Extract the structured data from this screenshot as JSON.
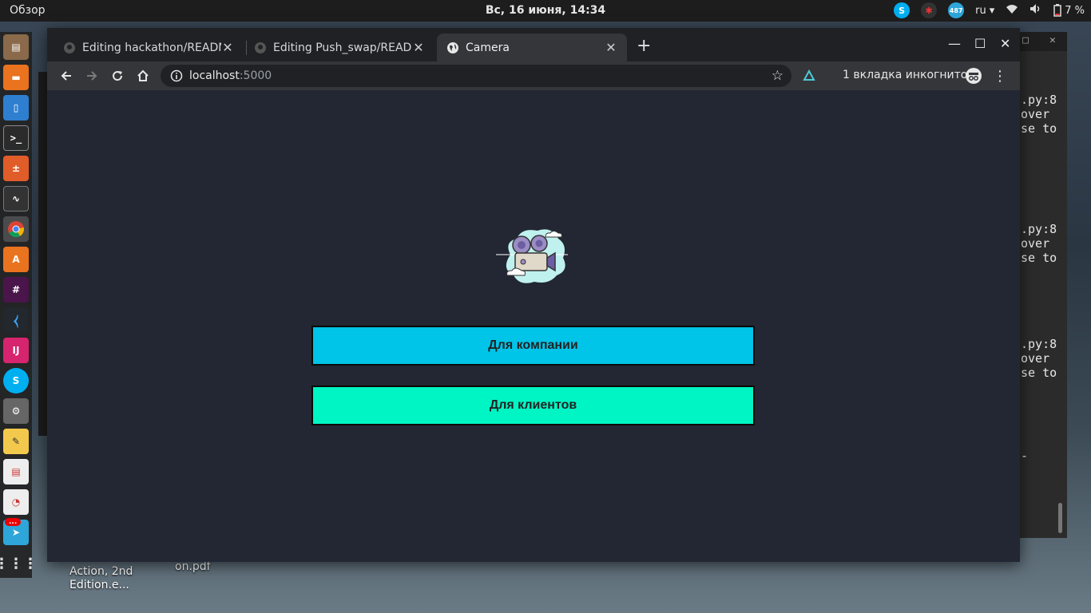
{
  "top_panel": {
    "overview": "Обзор",
    "clock": "Вс, 16 июня, 14:34",
    "lang": "ru",
    "battery": "7 %",
    "telegram_badge": "487"
  },
  "dock": {
    "items": [
      "files-cabinet",
      "folder",
      "document-viewer",
      "terminal",
      "calculator",
      "system-monitor",
      "chrome",
      "software-center",
      "slack",
      "vscode",
      "intellij",
      "skype",
      "settings",
      "text-editor",
      "pdf-viewer",
      "presentation",
      "telegram",
      "app-grid"
    ],
    "telegram_notif": "..."
  },
  "desktop": {
    "label1_line1": "Action, 2nd",
    "label1_line2": "Edition.e...",
    "label2": "on.pdf"
  },
  "terminal": {
    "lines": [
      ".py:8",
      " over",
      "se to",
      ".py:8",
      " over",
      "se to",
      ".py:8",
      " over",
      "se to",
      "-"
    ]
  },
  "browser": {
    "tabs": [
      {
        "title": "Editing hackathon/README",
        "icon": "github-icon"
      },
      {
        "title": "Editing Push_swap/READ",
        "icon": "github-icon"
      },
      {
        "title": "Camera",
        "icon": "globe-icon"
      }
    ],
    "url_host": "localhost",
    "url_port": ":5000",
    "incognito": "1 вкладка инкогнито"
  },
  "page": {
    "btn_company": "Для компании",
    "btn_clients": "Для клиентов"
  },
  "colors": {
    "btn_company": "#00c4e8",
    "btn_clients": "#00f5c4",
    "page_bg": "#222733"
  }
}
